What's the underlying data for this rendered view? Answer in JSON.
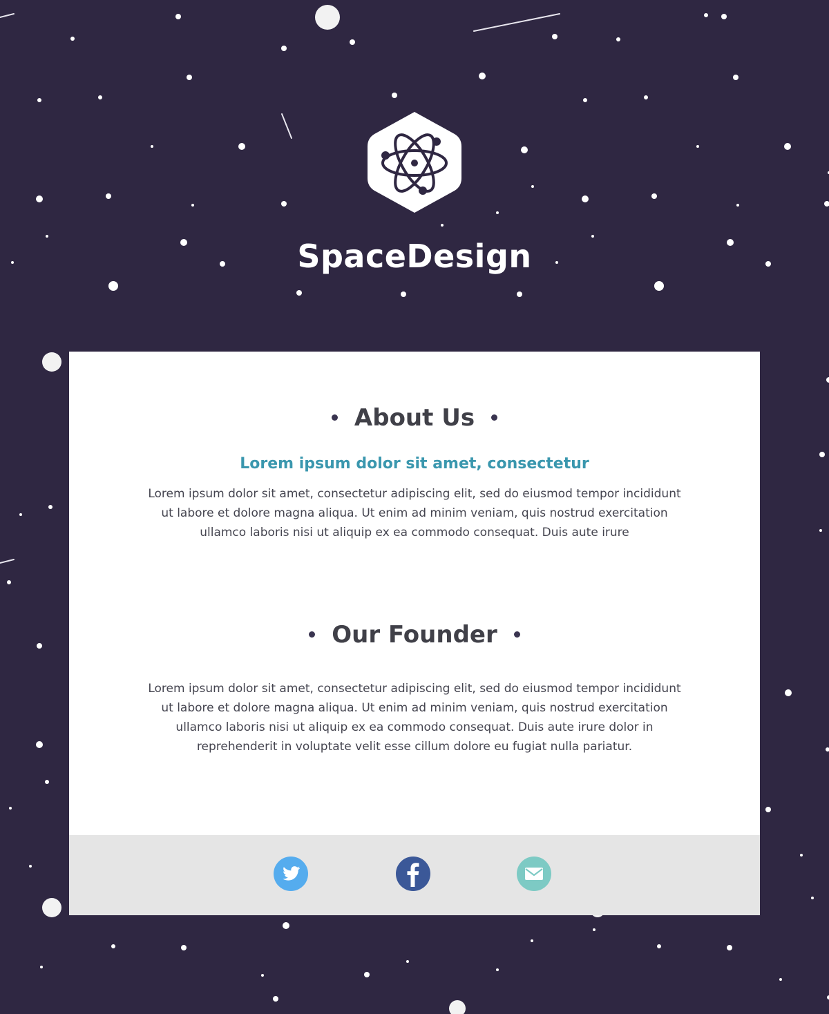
{
  "colors": {
    "background": "#2f2742",
    "card": "#ffffff",
    "footer": "#e5e5e5",
    "heading": "#404048",
    "accent": "#3a97ae",
    "body_text": "#454550",
    "twitter": "#55acee",
    "facebook": "#3b5898",
    "email": "#7dcac4"
  },
  "header": {
    "logo_icon": "atom-icon",
    "brand_name": "SpaceDesign"
  },
  "about": {
    "heading": "About Us",
    "subtitle": "Lorem ipsum dolor sit amet, consectetur",
    "text": "Lorem ipsum dolor sit amet, consectetur adipiscing elit, sed do eiusmod tempor incididunt ut labore et dolore magna aliqua. Ut enim ad minim veniam, quis nostrud exercitation ullamco laboris nisi ut aliquip ex ea commodo consequat. Duis aute irure"
  },
  "founder": {
    "heading": "Our Founder",
    "text": "Lorem ipsum dolor sit amet, consectetur adipiscing elit, sed do eiusmod tempor incididunt ut labore et dolore magna aliqua. Ut enim ad minim veniam, quis nostrud exercitation ullamco laboris nisi ut aliquip ex ea commodo consequat. Duis aute irure dolor in reprehenderit in voluptate velit esse cillum dolore eu fugiat nulla pariatur."
  },
  "footer": {
    "social": [
      {
        "icon": "twitter-icon"
      },
      {
        "icon": "facebook-icon"
      },
      {
        "icon": "email-icon"
      }
    ]
  }
}
